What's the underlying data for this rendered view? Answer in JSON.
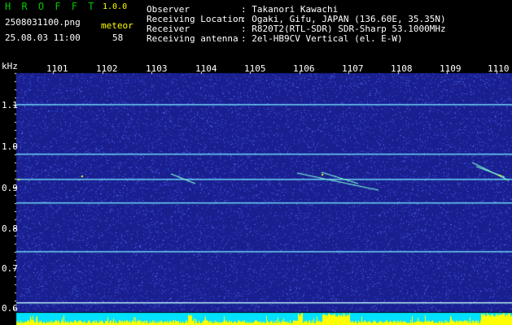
{
  "app": {
    "name": "H R O F F T",
    "version": "1.0.0"
  },
  "file": {
    "name": "2508031100.png",
    "timestamp": "25.08.03 11:00"
  },
  "meteor": {
    "label": "meteor",
    "count": "58"
  },
  "info": {
    "observer_label": "Observer",
    "observer_value": ": Takanori Kawachi",
    "location_label": "Receiving Location",
    "location_value": ": Ogaki, Gifu, JAPAN (136.60E, 35.35N)",
    "receiver_label": "Receiver",
    "receiver_value": ": R820T2(RTL-SDR) SDR-Sharp 53.1000MHz",
    "antenna_label": "Receiving antenna",
    "antenna_value": ": 2el-HB9CV Vertical (el. E-W)"
  },
  "axis": {
    "unit": "kHz",
    "time_ticks": [
      "1101",
      "1102",
      "1103",
      "1104",
      "1105",
      "1106",
      "1107",
      "1108",
      "1109",
      "1110"
    ],
    "freq_ticks": [
      "1.1",
      "1.0",
      "0.9",
      "0.8",
      "0.7",
      "0.6"
    ]
  },
  "colors": {
    "background": "#1a1f90",
    "noise": "#3d58e0",
    "bright": "#7fffd4",
    "signal": "#ffff00",
    "bottom_bar": "#00e0ff",
    "text_green": "#00c800",
    "text_yellow": "#ffff00"
  }
}
